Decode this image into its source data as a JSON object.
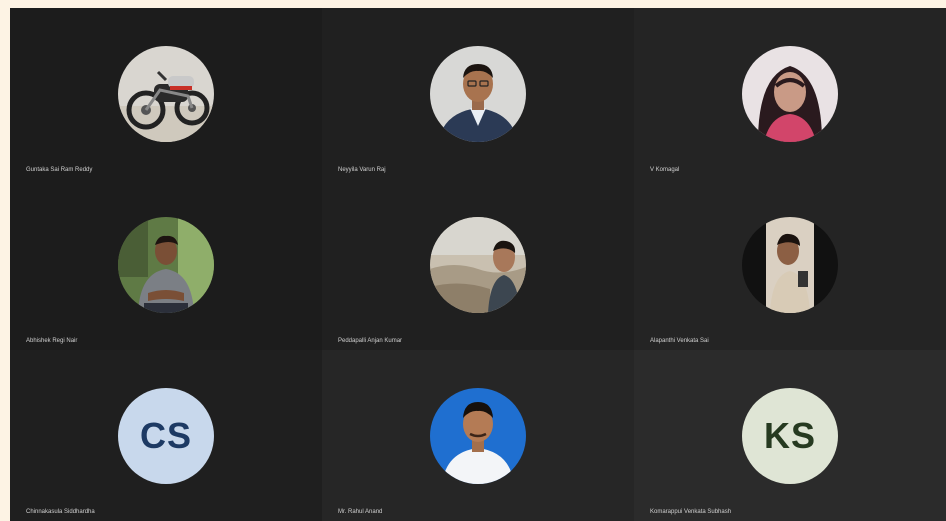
{
  "participants": [
    {
      "name": "Guntaka Sai Ram Reddy",
      "avatar": "motorcycle-photo"
    },
    {
      "name": "Neyyila Varun Raj",
      "avatar": "person-suit-photo"
    },
    {
      "name": "V Komagal",
      "avatar": "woman-selfie-photo"
    },
    {
      "name": "Abhishek Regi Nair",
      "avatar": "man-sitting-photo"
    },
    {
      "name": "Peddapalli Anjan Kumar",
      "avatar": "man-at-beach-photo"
    },
    {
      "name": "Alapanthi Venkata Sai",
      "avatar": "man-mirror-selfie-photo"
    },
    {
      "name": "Chinnakasula Siddhardha",
      "initials": "CS",
      "avatar_color": "#c8d8ec",
      "initials_color": "#1d3a64"
    },
    {
      "name": "Mr. Rahul Anand",
      "avatar": "man-blue-background-photo"
    },
    {
      "name": "Komarappui Venkata Subhash",
      "initials": "KS",
      "avatar_color": "#dfe5d5",
      "initials_color": "#263a20"
    }
  ]
}
